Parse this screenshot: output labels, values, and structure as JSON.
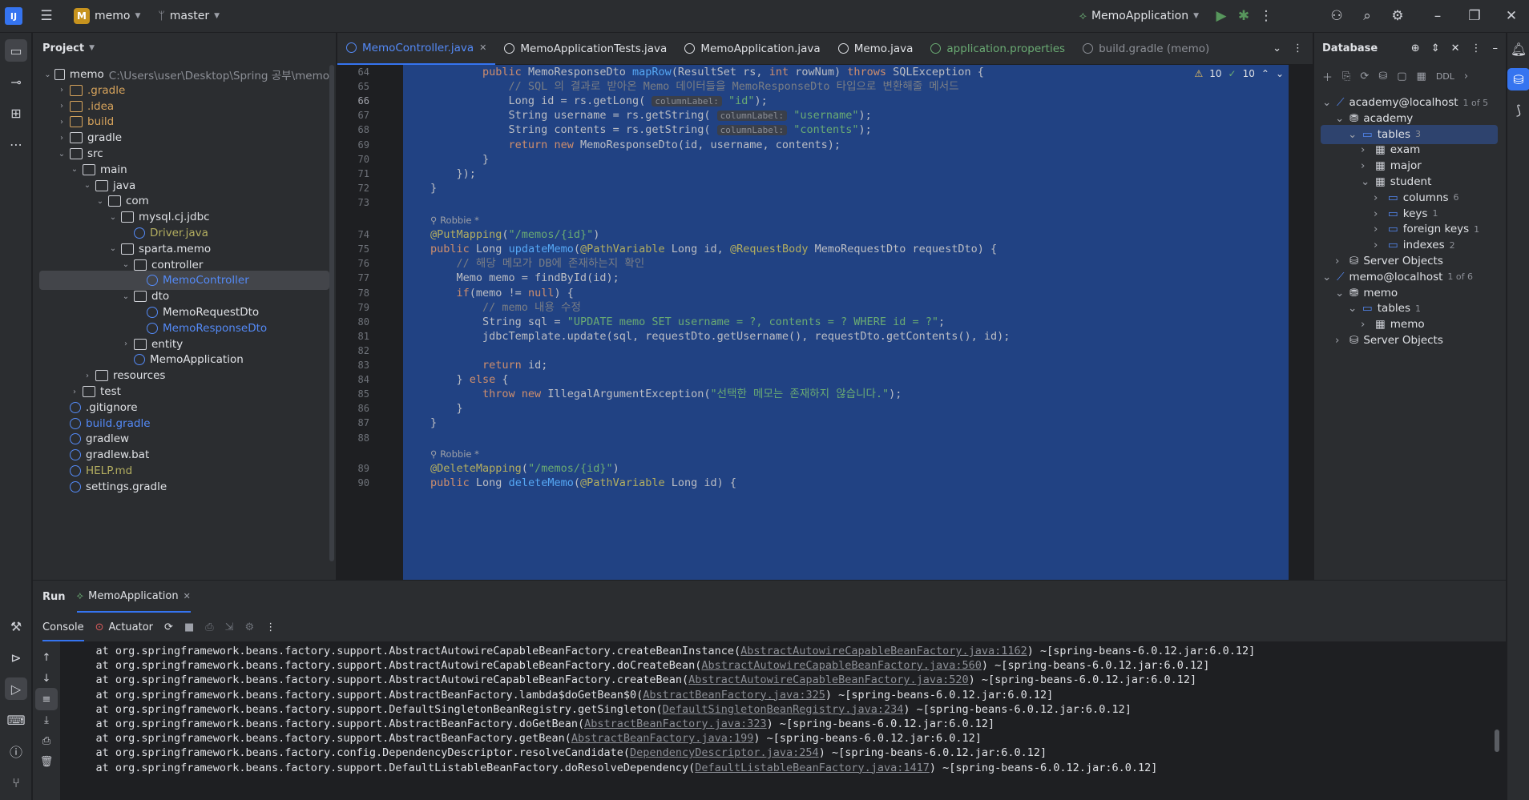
{
  "titlebar": {
    "project_badge": "M",
    "project_name": "memo",
    "branch": "master",
    "run_config": "MemoApplication"
  },
  "project_panel": {
    "title": "Project",
    "items": [
      {
        "label": "memo",
        "path": "C:\\Users\\user\\Desktop\\Spring 공부\\memo",
        "depth": 0,
        "open": true,
        "color": "#dfe1e5"
      },
      {
        "label": ".gradle",
        "depth": 1,
        "color": "#d6a35c",
        "orange": true
      },
      {
        "label": ".idea",
        "depth": 1,
        "color": "#d6a35c",
        "orange": true
      },
      {
        "label": "build",
        "depth": 1,
        "color": "#d6a35c",
        "orange": true
      },
      {
        "label": "gradle",
        "depth": 1,
        "color": "#dfe1e5"
      },
      {
        "label": "src",
        "depth": 1,
        "open": true,
        "color": "#dfe1e5"
      },
      {
        "label": "main",
        "depth": 2,
        "open": true,
        "color": "#dfe1e5"
      },
      {
        "label": "java",
        "depth": 3,
        "open": true,
        "color": "#dfe1e5"
      },
      {
        "label": "com",
        "depth": 4,
        "open": true,
        "color": "#dfe1e5"
      },
      {
        "label": "mysql.cj.jdbc",
        "depth": 5,
        "open": true,
        "color": "#dfe1e5"
      },
      {
        "label": "Driver.java",
        "depth": 6,
        "color": "#b3ae60"
      },
      {
        "label": "sparta.memo",
        "depth": 5,
        "open": true,
        "color": "#dfe1e5"
      },
      {
        "label": "controller",
        "depth": 6,
        "open": true,
        "color": "#dfe1e5"
      },
      {
        "label": "MemoController",
        "depth": 7,
        "color": "#548af7",
        "selected": true
      },
      {
        "label": "dto",
        "depth": 6,
        "open": true,
        "color": "#dfe1e5"
      },
      {
        "label": "MemoRequestDto",
        "depth": 7,
        "color": "#dfe1e5"
      },
      {
        "label": "MemoResponseDto",
        "depth": 7,
        "color": "#548af7"
      },
      {
        "label": "entity",
        "depth": 6,
        "color": "#dfe1e5"
      },
      {
        "label": "MemoApplication",
        "depth": 6,
        "color": "#dfe1e5"
      },
      {
        "label": "resources",
        "depth": 3,
        "color": "#dfe1e5"
      },
      {
        "label": "test",
        "depth": 2,
        "color": "#dfe1e5"
      },
      {
        "label": ".gitignore",
        "depth": 1,
        "color": "#dfe1e5"
      },
      {
        "label": "build.gradle",
        "depth": 1,
        "color": "#548af7"
      },
      {
        "label": "gradlew",
        "depth": 1,
        "color": "#dfe1e5"
      },
      {
        "label": "gradlew.bat",
        "depth": 1,
        "color": "#dfe1e5"
      },
      {
        "label": "HELP.md",
        "depth": 1,
        "color": "#b3ae60"
      },
      {
        "label": "settings.gradle",
        "depth": 1,
        "color": "#dfe1e5"
      }
    ]
  },
  "tabs": [
    {
      "label": "MemoController.java",
      "active": true,
      "color": "#548af7"
    },
    {
      "label": "MemoApplicationTests.java",
      "color": "#dfe1e5"
    },
    {
      "label": "MemoApplication.java",
      "color": "#dfe1e5"
    },
    {
      "label": "Memo.java",
      "color": "#dfe1e5"
    },
    {
      "label": "application.properties",
      "color": "#6aab73"
    },
    {
      "label": "build.gradle (memo)",
      "color": "#8c8f96"
    }
  ],
  "editor": {
    "inspections": {
      "warnings": "10",
      "checks": "10"
    },
    "lines": [
      {
        "n": "64",
        "html": "        <span class='kw'>public</span> MemoResponseDto <span class='fn'>mapRow</span>(ResultSet rs, <span class='kw'>int</span> rowNum) <span class='kw'>throws</span> SQLException {"
      },
      {
        "n": "65",
        "html": "            <span class='cm'>// SQL 의 결과로 받아온 Memo 데이터들을 MemoResponseDto 타입으로 변환해줄 메서드</span>"
      },
      {
        "n": "66",
        "html": "            Long id = rs.getLong( <span class='hint'>columnLabel:</span> <span class='str'>\"id\"</span>);"
      },
      {
        "n": "67",
        "html": "            String username = rs.getString( <span class='hint'>columnLabel:</span> <span class='str'>\"username\"</span>);"
      },
      {
        "n": "68",
        "html": "            String contents = rs.getString( <span class='hint'>columnLabel:</span> <span class='str'>\"contents\"</span>);"
      },
      {
        "n": "69",
        "html": "            <span class='kw'>return new</span> MemoResponseDto(id, username, contents);"
      },
      {
        "n": "70",
        "html": "        }"
      },
      {
        "n": "71",
        "html": "    });"
      },
      {
        "n": "72",
        "html": "}"
      },
      {
        "n": "73",
        "html": ""
      },
      {
        "n": "",
        "html": "",
        "author": "Robbie *"
      },
      {
        "n": "74",
        "html": "<span class='an'>@PutMapping</span>(<span class='str'>\"/memos/{id}\"</span>)"
      },
      {
        "n": "75",
        "html": "<span class='kw'>public</span> Long <span class='fn'>updateMemo</span>(<span class='an'>@PathVariable</span> Long id, <span class='an'>@RequestBody</span> MemoRequestDto requestDto) {"
      },
      {
        "n": "76",
        "html": "    <span class='cm'>// 해당 메모가 DB에 존재하는지 확인</span>"
      },
      {
        "n": "77",
        "html": "    Memo memo = findById(id);"
      },
      {
        "n": "78",
        "html": "    <span class='kw'>if</span>(memo != <span class='kw'>null</span>) {"
      },
      {
        "n": "79",
        "html": "        <span class='cm'>// memo 내용 수정</span>"
      },
      {
        "n": "80",
        "html": "        String sql = <span class='str'>\"UPDATE memo SET username = ?, contents = ? WHERE id = ?\"</span>;"
      },
      {
        "n": "81",
        "html": "        jdbcTemplate.update(sql, requestDto.getUsername(), requestDto.getContents(), id);"
      },
      {
        "n": "82",
        "html": ""
      },
      {
        "n": "83",
        "html": "        <span class='kw'>return</span> id;"
      },
      {
        "n": "84",
        "html": "    } <span class='kw'>else</span> {"
      },
      {
        "n": "85",
        "html": "        <span class='kw'>throw new</span> IllegalArgumentException(<span class='str'>\"선택한 메모는 존재하지 않습니다.\"</span>);"
      },
      {
        "n": "86",
        "html": "    }"
      },
      {
        "n": "87",
        "html": "}"
      },
      {
        "n": "88",
        "html": ""
      },
      {
        "n": "",
        "html": "",
        "author": "Robbie *"
      },
      {
        "n": "89",
        "html": "<span class='an'>@DeleteMapping</span>(<span class='str'>\"/memos/{id}\"</span>)"
      },
      {
        "n": "90",
        "html": "<span class='kw'>public</span> Long <span class='fn'>deleteMemo</span>(<span class='an'>@PathVariable</span> Long id) {"
      }
    ]
  },
  "database": {
    "title": "Database",
    "ddl": "DDL",
    "rows": [
      {
        "label": "academy@localhost",
        "count": "1 of 5",
        "depth": 0,
        "open": true
      },
      {
        "label": "academy",
        "depth": 1,
        "open": true
      },
      {
        "label": "tables",
        "count": "3",
        "depth": 2,
        "open": true,
        "selected": true
      },
      {
        "label": "exam",
        "depth": 3
      },
      {
        "label": "major",
        "depth": 3
      },
      {
        "label": "student",
        "depth": 3,
        "open": true
      },
      {
        "label": "columns",
        "count": "6",
        "depth": 4
      },
      {
        "label": "keys",
        "count": "1",
        "depth": 4
      },
      {
        "label": "foreign keys",
        "count": "1",
        "depth": 4
      },
      {
        "label": "indexes",
        "count": "2",
        "depth": 4
      },
      {
        "label": "Server Objects",
        "depth": 1
      },
      {
        "label": "memo@localhost",
        "count": "1 of 6",
        "depth": 0,
        "open": true
      },
      {
        "label": "memo",
        "depth": 1,
        "open": true
      },
      {
        "label": "tables",
        "count": "1",
        "depth": 2,
        "open": true
      },
      {
        "label": "memo",
        "depth": 3
      },
      {
        "label": "Server Objects",
        "depth": 1
      }
    ]
  },
  "run": {
    "tab_run": "Run",
    "tab_app": "MemoApplication",
    "console": "Console",
    "actuator": "Actuator",
    "lines": [
      {
        "pre": "    at org.springframework.beans.factory.support.AbstractAutowireCapableBeanFactory.createBeanInstance(",
        "link": "AbstractAutowireCapableBeanFactory.java:1162",
        "post": ") ~[spring-beans-6.0.12.jar:6.0.12]"
      },
      {
        "pre": "    at org.springframework.beans.factory.support.AbstractAutowireCapableBeanFactory.doCreateBean(",
        "link": "AbstractAutowireCapableBeanFactory.java:560",
        "post": ") ~[spring-beans-6.0.12.jar:6.0.12]"
      },
      {
        "pre": "    at org.springframework.beans.factory.support.AbstractAutowireCapableBeanFactory.createBean(",
        "link": "AbstractAutowireCapableBeanFactory.java:520",
        "post": ") ~[spring-beans-6.0.12.jar:6.0.12]"
      },
      {
        "pre": "    at org.springframework.beans.factory.support.AbstractBeanFactory.lambda$doGetBean$0(",
        "link": "AbstractBeanFactory.java:325",
        "post": ") ~[spring-beans-6.0.12.jar:6.0.12]"
      },
      {
        "pre": "    at org.springframework.beans.factory.support.DefaultSingletonBeanRegistry.getSingleton(",
        "link": "DefaultSingletonBeanRegistry.java:234",
        "post": ") ~[spring-beans-6.0.12.jar:6.0.12]"
      },
      {
        "pre": "    at org.springframework.beans.factory.support.AbstractBeanFactory.doGetBean(",
        "link": "AbstractBeanFactory.java:323",
        "post": ") ~[spring-beans-6.0.12.jar:6.0.12]"
      },
      {
        "pre": "    at org.springframework.beans.factory.support.AbstractBeanFactory.getBean(",
        "link": "AbstractBeanFactory.java:199",
        "post": ") ~[spring-beans-6.0.12.jar:6.0.12]"
      },
      {
        "pre": "    at org.springframework.beans.factory.config.DependencyDescriptor.resolveCandidate(",
        "link": "DependencyDescriptor.java:254",
        "post": ") ~[spring-beans-6.0.12.jar:6.0.12]"
      },
      {
        "pre": "    at org.springframework.beans.factory.support.DefaultListableBeanFactory.doResolveDependency(",
        "link": "DefaultListableBeanFactory.java:1417",
        "post": ") ~[spring-beans-6.0.12.jar:6.0.12]"
      }
    ]
  }
}
